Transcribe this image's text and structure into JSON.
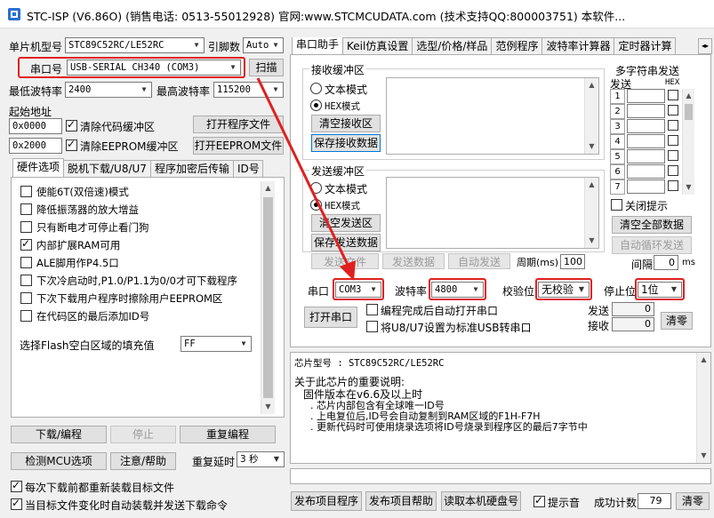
{
  "title": "STC-ISP (V6.86O) (销售电话: 0513-55012928) 官网:www.STCMCUDATA.com (技术支持QQ:800003751) 本软件...",
  "left": {
    "mcu_label": "单片机型号",
    "mcu_value": "STC89C52RC/LE52RC",
    "pins_label": "引脚数",
    "pins_value": "Auto",
    "port_label": "串口号",
    "port_value": "USB-SERIAL CH340 (COM3)",
    "scan_btn": "扫描",
    "min_baud_label": "最低波特率",
    "min_baud_value": "2400",
    "max_baud_label": "最高波特率",
    "max_baud_value": "115200",
    "start_addr_label": "起始地址",
    "addr1": "0x0000",
    "clear_code": "清除代码缓冲区",
    "open_prog": "打开程序文件",
    "addr2": "0x2000",
    "clear_eeprom": "清除EEPROM缓冲区",
    "open_eeprom": "打开EEPROM文件",
    "tabs": [
      "硬件选项",
      "脱机下载/U8/U7",
      "程序加密后传输",
      "ID号"
    ],
    "options": [
      {
        "label": "使能6T(双倍速)模式",
        "checked": false
      },
      {
        "label": "降低振荡器的放大增益",
        "checked": false
      },
      {
        "label": "只有断电才可停止看门狗",
        "checked": false
      },
      {
        "label": "内部扩展RAM可用",
        "checked": true
      },
      {
        "label": "ALE脚用作P4.5口",
        "checked": false
      },
      {
        "label": "下次冷启动时,P1.0/P1.1为0/0才可下载程序",
        "checked": false
      },
      {
        "label": "下次下载用户程序时擦除用户EEPROM区",
        "checked": false
      },
      {
        "label": "在代码区的最后添加ID号",
        "checked": false
      }
    ],
    "flash_fill_label": "选择Flash空白区域的填充值",
    "flash_fill_value": "FF",
    "download_btn": "下载/编程",
    "stop_btn": "停止",
    "reprogram_btn": "重复编程",
    "detect_btn": "检测MCU选项",
    "help_btn": "注意/帮助",
    "repeat_delay_label": "重复延时",
    "repeat_delay_value": "3 秒",
    "reload_label": "每次下载前都重新装载目标文件",
    "autoload_label": "当目标文件变化时自动装载并发送下载命令"
  },
  "right": {
    "tabs": [
      "串口助手",
      "Keil仿真设置",
      "选型/价格/样品",
      "范例程序",
      "波特率计算器",
      "定时器计算"
    ],
    "recv_title": "接收缓冲区",
    "text_mode": "文本模式",
    "hex_mode": "HEX模式",
    "clear_recv": "清空接收区",
    "save_recv": "保存接收数据",
    "send_title": "发送缓冲区",
    "clear_send": "清空发送区",
    "save_send": "保存发送数据",
    "send_file": "发送文件",
    "send_data": "发送数据",
    "auto_send": "自动发送",
    "period_label": "周期(ms)",
    "period_value": "100",
    "multi_title": "多字符串发送",
    "send_col": "发送",
    "hex_col": "HEX",
    "rows": [
      "1",
      "2",
      "3",
      "4",
      "5",
      "6",
      "7"
    ],
    "close_tip": "关闭提示",
    "clear_all": "清空全部数据",
    "auto_loop": "自动循环发送",
    "interval_label": "间隔",
    "interval_value": "0",
    "interval_unit": "ms",
    "port_label": "串口",
    "port_value": "COM3",
    "baud_label": "波特率",
    "baud_value": "4800",
    "parity_label": "校验位",
    "parity_value": "无校验",
    "stop_label": "停止位",
    "stop_value": "1位",
    "open_port": "打开串口",
    "auto_open": "编程完成后自动打开串口",
    "usb_convert": "将U8/U7设置为标准USB转串口",
    "send_count_label": "发送",
    "send_count": "0",
    "recv_count_label": "接收",
    "recv_count": "0",
    "clear_count": "清零"
  },
  "info": {
    "chip_line": "芯片型号 : STC89C52RC/LE52RC",
    "notes_title": "关于此芯片的重要说明:",
    "notes": [
      "固件版本在v6.6及以上时",
      ". 芯片内部包含有全球唯一ID号",
      ". 上电复位后,ID号会自动复制到RAM区域的F1H-F7H",
      ". 更新代码时可使用烧录选项将ID号烧录到程序区的最后7字节中"
    ]
  },
  "bottom": {
    "publish_prog": "发布项目程序",
    "publish_help": "发布项目帮助",
    "read_disk": "读取本机硬盘号",
    "tip_sound": "提示音",
    "success_label": "成功计数",
    "success_value": "79",
    "clear_btn": "清零"
  },
  "colors": {
    "highlight": "#e02020",
    "window_bg": "#f0f0f0"
  }
}
